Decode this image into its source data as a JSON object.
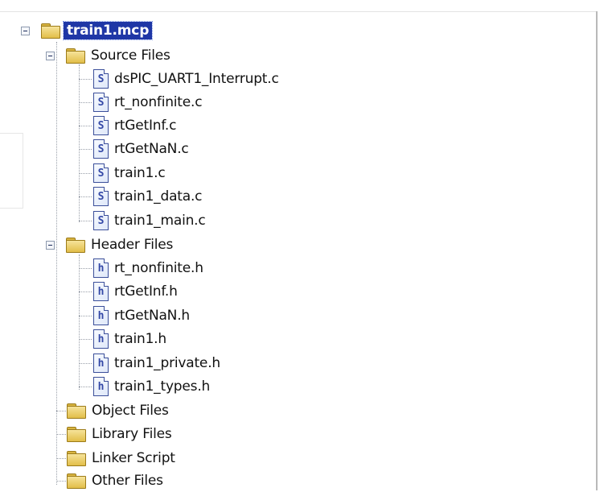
{
  "project": {
    "name": "train1.mcp"
  },
  "folders": {
    "source": {
      "label": "Source Files",
      "files": [
        "dsPIC_UART1_Interrupt.c",
        "rt_nonfinite.c",
        "rtGetInf.c",
        "rtGetNaN.c",
        "train1.c",
        "train1_data.c",
        "train1_main.c"
      ]
    },
    "header": {
      "label": "Header Files",
      "files": [
        "rt_nonfinite.h",
        "rtGetInf.h",
        "rtGetNaN.h",
        "train1.h",
        "train1_private.h",
        "train1_types.h"
      ]
    },
    "object": {
      "label": "Object Files"
    },
    "library": {
      "label": "Library Files"
    },
    "linker": {
      "label": "Linker Script"
    },
    "other": {
      "label": "Other Files"
    }
  },
  "icons": {
    "c_file_glyph": "S",
    "h_file_glyph": "h",
    "folder": "folder-icon",
    "collapse": "collapse-icon"
  },
  "colors": {
    "selection": "#1f37a6",
    "folder": "#e2be49",
    "file_border": "#3b4f9a"
  }
}
